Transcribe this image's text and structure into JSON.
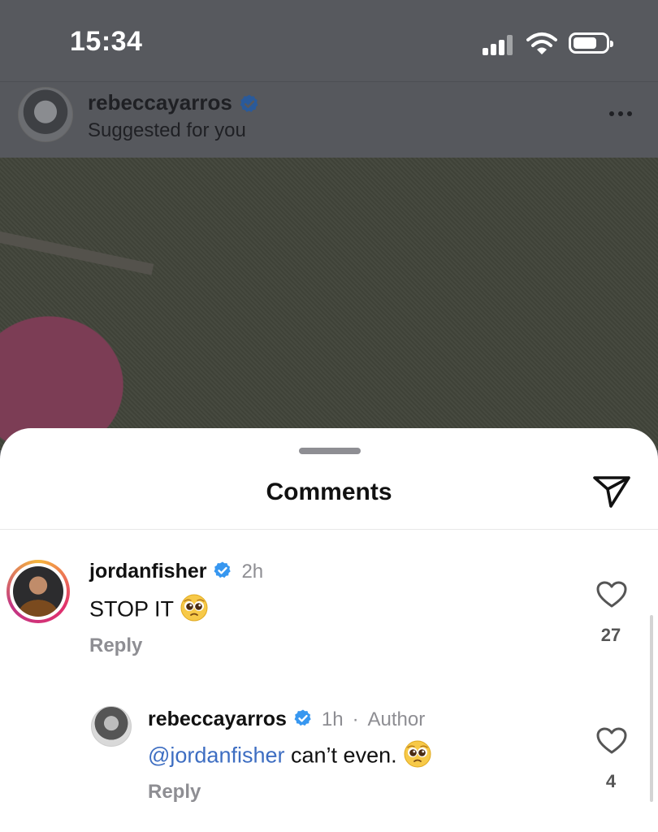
{
  "status_bar": {
    "time": "15:34"
  },
  "post": {
    "username": "rebeccayarros",
    "subtitle": "Suggested for you",
    "more_icon": "ellipsis-icon"
  },
  "comments_sheet": {
    "title": "Comments",
    "share_icon": "paper-plane-icon",
    "comments": [
      {
        "username": "jordanfisher",
        "verified": true,
        "time": "2h",
        "text": "STOP IT",
        "emoji": "🥺",
        "reply_label": "Reply",
        "likes": "27"
      },
      {
        "username": "rebeccayarros",
        "verified": true,
        "time": "1h",
        "separator": "·",
        "author_label": "Author",
        "mention": "@jordanfisher",
        "text": "can’t even.",
        "emoji": "🥺",
        "reply_label": "Reply",
        "likes": "4"
      }
    ]
  },
  "colors": {
    "verified_blue": "#3797f0",
    "mention_blue": "#3e6ec2",
    "secondary_text": "#8e8e93"
  }
}
